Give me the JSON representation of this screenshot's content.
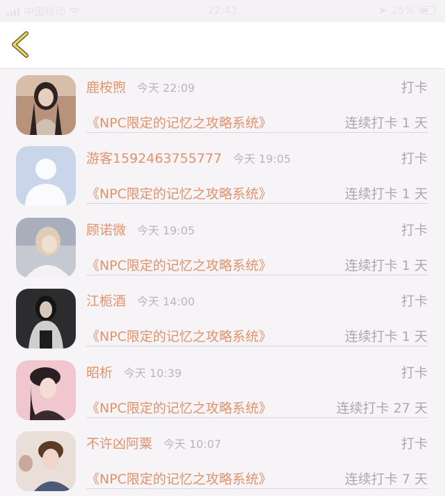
{
  "status_bar": {
    "carrier": "中国移动",
    "time": "22:43",
    "battery": "25%"
  },
  "colors": {
    "accent": "#e2926c",
    "back_arrow": "#f0d94a",
    "muted": "#aaa8ac"
  },
  "records": [
    {
      "name": "鹿桉煦",
      "time": "今天 22:09",
      "action": "打卡",
      "book": "《NPC限定的记忆之攻略系统》",
      "streak": "连续打卡 1 天"
    },
    {
      "name": "游客1592463755777",
      "time": "今天 19:05",
      "action": "打卡",
      "book": "《NPC限定的记忆之攻略系统》",
      "streak": "连续打卡 1 天"
    },
    {
      "name": "顾诺微",
      "time": "今天 19:05",
      "action": "打卡",
      "book": "《NPC限定的记忆之攻略系统》",
      "streak": "连续打卡 1 天"
    },
    {
      "name": "江栀酒",
      "time": "今天 14:00",
      "action": "打卡",
      "book": "《NPC限定的记忆之攻略系统》",
      "streak": "连续打卡 1 天"
    },
    {
      "name": "昭析",
      "time": "今天 10:39",
      "action": "打卡",
      "book": "《NPC限定的记忆之攻略系统》",
      "streak": "连续打卡 27 天"
    },
    {
      "name": "不许凶阿粟",
      "time": "今天 10:07",
      "action": "打卡",
      "book": "《NPC限定的记忆之攻略系统》",
      "streak": "连续打卡 7 天"
    }
  ]
}
